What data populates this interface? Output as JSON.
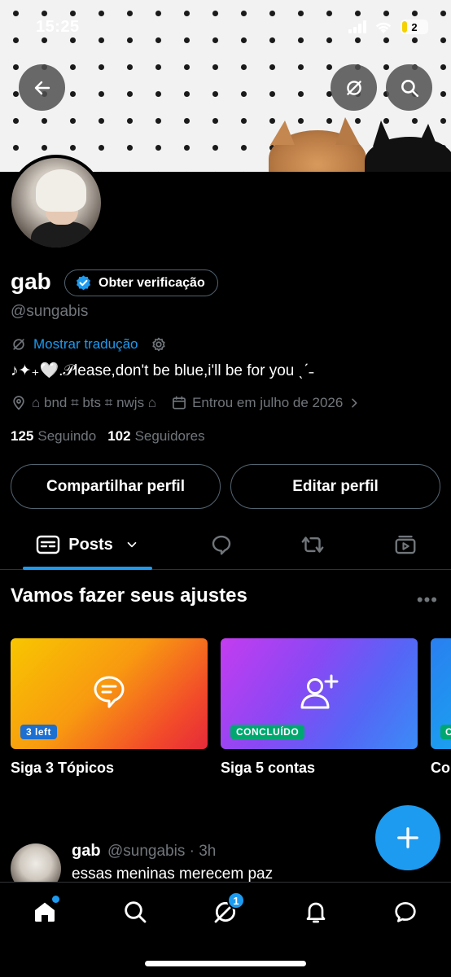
{
  "status_bar": {
    "time": "15:25",
    "battery": "2"
  },
  "profile": {
    "name": "gab",
    "verify_label": "Obter verificação",
    "handle": "@sungabis",
    "translate_label": "Mostrar tradução",
    "bio": "♪✦₊🤍.𝒫lease,don't be blue,i'll be for you ˎˊ˗",
    "location": "⌂ bnd ⌗ bts ⌗ nwjs ⌂",
    "joined": "Entrou em julho de 2026",
    "following_count": "125",
    "following_label": "Seguindo",
    "followers_count": "102",
    "followers_label": "Seguidores"
  },
  "actions": {
    "share_label": "Compartilhar perfil",
    "edit_label": "Editar perfil"
  },
  "tabs": {
    "posts_label": "Posts"
  },
  "setup": {
    "title": "Vamos fazer seus ajustes",
    "cards": [
      {
        "badge": "3 left",
        "label": "Siga 3 Tópicos"
      },
      {
        "badge": "CONCLUÍDO",
        "label": "Siga 5 contas"
      },
      {
        "badge": "C",
        "label": "Co"
      }
    ]
  },
  "post": {
    "name": "gab",
    "handle": "@sungabis · 3h",
    "text": "essas meninas merecem paz"
  },
  "nav": {
    "messages_badge": "1"
  },
  "colors": {
    "accent": "#1d9bf0",
    "background": "#000000",
    "muted": "#71767b",
    "border": "#536471",
    "success": "#00ba7c"
  },
  "icons": [
    "back-arrow-icon",
    "translate-icon",
    "search-icon",
    "verified-icon",
    "gear-icon",
    "location-icon",
    "calendar-icon",
    "chevron-right-icon",
    "posts-icon",
    "chevron-down-icon",
    "reply-icon",
    "repost-icon",
    "video-icon",
    "topic-chat-icon",
    "add-user-icon",
    "plus-icon",
    "home-icon",
    "grok-icon",
    "bell-icon",
    "message-icon"
  ]
}
